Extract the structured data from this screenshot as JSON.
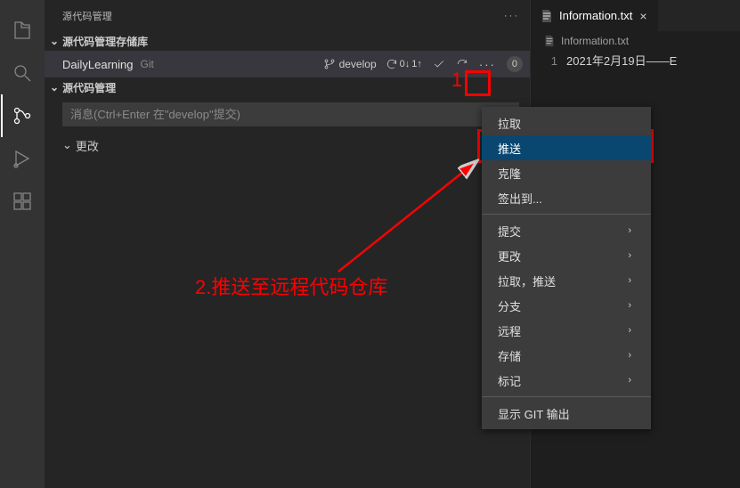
{
  "activity_bar": {
    "icons": [
      "explorer",
      "search",
      "scm",
      "debug",
      "extensions"
    ]
  },
  "sidebar": {
    "title": "源代码管理",
    "repositories_section": "源代码管理存储库",
    "repo": {
      "name": "DailyLearning",
      "type": "Git",
      "branch": "develop",
      "sync_down": "0↓",
      "sync_up": "1↑",
      "badge": "0"
    },
    "scm_section": "源代码管理",
    "commit_placeholder": "消息(Ctrl+Enter 在\"develop\"提交)",
    "changes_label": "更改"
  },
  "editor": {
    "tab_name": "Information.txt",
    "crumb": "Information.txt",
    "line_number": "1",
    "content": "2021年2月19日——E"
  },
  "context_menu": {
    "items": [
      {
        "label": "拉取",
        "submenu": false
      },
      {
        "label": "推送",
        "submenu": false,
        "highlight": true
      },
      {
        "label": "克隆",
        "submenu": false
      },
      {
        "label": "签出到...",
        "submenu": false
      },
      "sep",
      {
        "label": "提交",
        "submenu": true
      },
      {
        "label": "更改",
        "submenu": true
      },
      {
        "label": "拉取，推送",
        "submenu": true
      },
      {
        "label": "分支",
        "submenu": true
      },
      {
        "label": "远程",
        "submenu": true
      },
      {
        "label": "存储",
        "submenu": true
      },
      {
        "label": "标记",
        "submenu": true
      },
      "sep",
      {
        "label": "显示 GIT 输出",
        "submenu": false
      }
    ]
  },
  "annotations": {
    "marker1": "1",
    "marker2": "2.推送至远程代码仓库"
  },
  "colors": {
    "accent": "#094771",
    "red": "#ff0000"
  }
}
